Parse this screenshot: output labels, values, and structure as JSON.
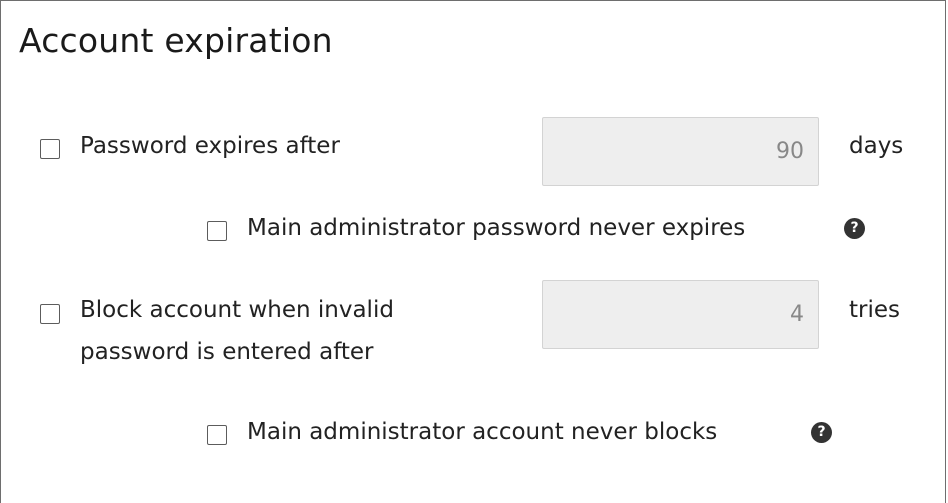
{
  "section": {
    "title": "Account expiration"
  },
  "password_expiry": {
    "label": "Password expires after",
    "value": "90",
    "unit": "days",
    "checked": false
  },
  "admin_password_never_expires": {
    "label": "Main administrator password never expires",
    "checked": false,
    "help_icon": "question-circle-icon",
    "help_glyph": "?"
  },
  "block_account": {
    "label_line1": "Block account when invalid",
    "label_line2": "password is entered after",
    "value": "4",
    "unit": "tries",
    "checked": false
  },
  "admin_account_never_blocks": {
    "label": "Main administrator account never blocks",
    "checked": false,
    "help_icon": "question-circle-icon",
    "help_glyph": "?"
  }
}
